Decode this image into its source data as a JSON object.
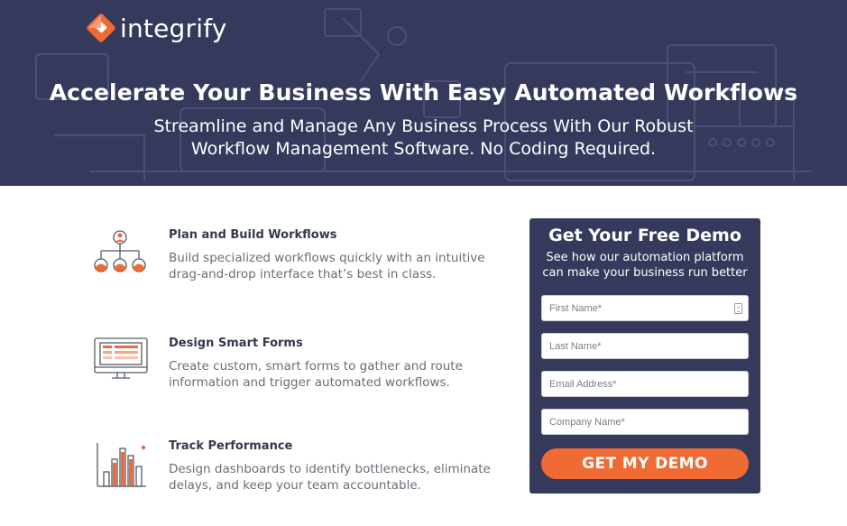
{
  "brand": {
    "name": "integrify"
  },
  "hero": {
    "title": "Accelerate Your Business With Easy Automated Workflows",
    "subtitle_line1": "Streamline and Manage Any Business Process With Our Robust",
    "subtitle_line2": "Workflow Management Software. No Coding Required."
  },
  "features": [
    {
      "icon": "org-chart-icon",
      "title": "Plan and Build Workflows",
      "desc_line1": "Build specialized workflows quickly with an intuitive",
      "desc_line2": "drag-and-drop interface that’s best in class."
    },
    {
      "icon": "form-monitor-icon",
      "title": "Design Smart Forms",
      "desc_line1": "Create custom, smart forms to gather and route",
      "desc_line2": "information and trigger automated workflows."
    },
    {
      "icon": "bar-chart-icon",
      "title": "Track Performance",
      "desc_line1": "Design dashboards to identify bottlenecks, eliminate",
      "desc_line2": "delays, and keep your team accountable."
    }
  ],
  "form": {
    "title": "Get Your Free Demo",
    "subtitle_line1": "See how our automation platform",
    "subtitle_line2": "can make your business run better",
    "first_name_placeholder": "First Name*",
    "last_name_placeholder": "Last Name*",
    "email_placeholder": "Email Address*",
    "company_placeholder": "Company Name*",
    "submit_label": "GET MY DEMO"
  },
  "colors": {
    "navy": "#353a5c",
    "accent_orange": "#f06a33",
    "text_dark": "#333a4d",
    "text_muted": "#6a6e78"
  }
}
